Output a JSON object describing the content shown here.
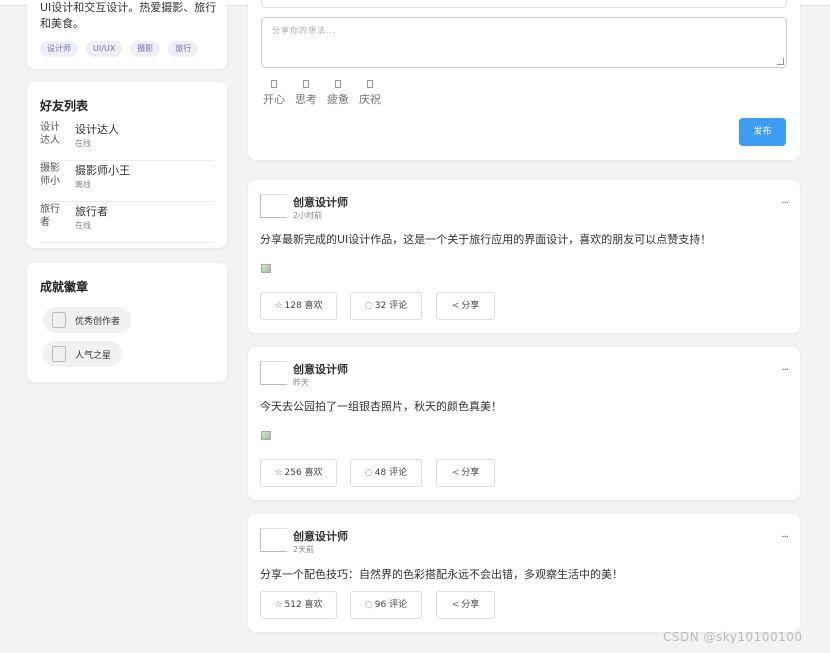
{
  "profile": {
    "bio": "UI设计和交互设计。热爱摄影、旅行和美食。",
    "tags": [
      "设计师",
      "UI/UX",
      "摄影",
      "旅行"
    ]
  },
  "friends": {
    "title": "好友列表",
    "items": [
      {
        "avatar_alt": "设计达人",
        "name": "设计达人",
        "status": "在线"
      },
      {
        "avatar_alt": "摄影师小王",
        "name": "摄影师小王",
        "status": "离线"
      },
      {
        "avatar_alt": "旅行者",
        "name": "旅行者",
        "status": "在线"
      }
    ]
  },
  "badges": {
    "title": "成就徽章",
    "items": [
      {
        "name": "优秀创作者",
        "icon": "badge-image-icon"
      },
      {
        "name": "人气之星",
        "icon": "badge-image-icon"
      }
    ]
  },
  "composer": {
    "placeholder": "分享你的想法...",
    "moods": [
      {
        "icon": "happy-icon",
        "label": "开心"
      },
      {
        "icon": "thinking-icon",
        "label": "思考"
      },
      {
        "icon": "tired-icon",
        "label": "疲惫"
      },
      {
        "icon": "celebrate-icon",
        "label": "庆祝"
      }
    ],
    "publish_label": "发布",
    "accent": "#3d9cf3"
  },
  "posts": [
    {
      "author": "创意设计师",
      "time": "2小时前",
      "content": "分享最新完成的UI设计作品，这是一个关于旅行应用的界面设计，喜欢的朋友可以点赞支持！",
      "has_image": true,
      "like_label": "128 喜欢",
      "comment_label": "32 评论",
      "share_label": "分享"
    },
    {
      "author": "创意设计师",
      "time": "昨天",
      "content": "今天去公园拍了一组银杏照片，秋天的颜色真美！",
      "has_image": true,
      "like_label": "256 喜欢",
      "comment_label": "48 评论",
      "share_label": "分享"
    },
    {
      "author": "创意设计师",
      "time": "2天前",
      "content": "分享一个配色技巧：自然界的色彩搭配永远不会出错，多观察生活中的美！",
      "has_image": false,
      "like_label": "512 喜欢",
      "comment_label": "96 评论",
      "share_label": "分享"
    }
  ],
  "icons": {
    "like": "☆",
    "comment": "◌",
    "share": "<",
    "more": "···"
  },
  "watermark": "CSDN @sky10100100"
}
